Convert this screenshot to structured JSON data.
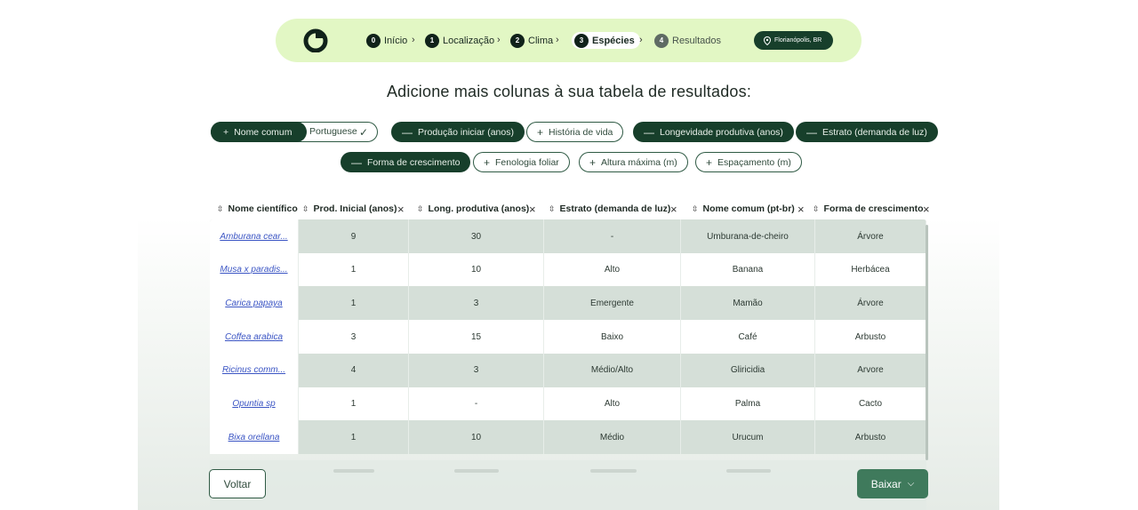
{
  "stepper": {
    "steps": [
      {
        "num": "0",
        "label": "Início"
      },
      {
        "num": "1",
        "label": "Localização"
      },
      {
        "num": "2",
        "label": "Clima"
      },
      {
        "num": "3",
        "label": "Espécies"
      },
      {
        "num": "4",
        "label": "Resultados"
      }
    ],
    "active_step": "3",
    "location": "Florianópolis, BR"
  },
  "heading": "Adicione mais colunas à sua tabela de resultados:",
  "chips": [
    {
      "label": "Nome comum",
      "selected": true,
      "option": "Portuguese"
    },
    {
      "label": "Produção iniciar (anos)",
      "selected": true
    },
    {
      "label": "História de vida",
      "selected": false
    },
    {
      "label": "Longevidade produtiva (anos)",
      "selected": true
    },
    {
      "label": "Estrato (demanda de luz)",
      "selected": true
    },
    {
      "label": "Forma de crescimento",
      "selected": true
    },
    {
      "label": "Fenologia foliar",
      "selected": false
    },
    {
      "label": "Altura máxima (m)",
      "selected": false
    },
    {
      "label": "Espaçamento (m)",
      "selected": false
    }
  ],
  "table": {
    "columns": [
      "Nome científico",
      "Prod. Inicial (anos)",
      "Long. produtiva (anos)",
      "Estrato (demanda de luz)",
      "Nome comum (pt-br)",
      "Forma de crescimento"
    ],
    "rows": [
      [
        "Amburana cear...",
        "9",
        "30",
        "-",
        "Umburana-de-cheiro",
        "Árvore"
      ],
      [
        "Musa x paradis...",
        "1",
        "10",
        "Alto",
        "Banana",
        "Herbácea"
      ],
      [
        "Carica papaya",
        "1",
        "3",
        "Emergente",
        "Mamão",
        "Árvore"
      ],
      [
        "Coffea arabica",
        "3",
        "15",
        "Baixo",
        "Café",
        "Arbusto"
      ],
      [
        "Ricinus comm...",
        "4",
        "3",
        "Médio/Alto",
        "Gliricidia",
        "Arvore"
      ],
      [
        "Opuntia sp",
        "1",
        "-",
        "Alto",
        "Palma",
        "Cacto"
      ],
      [
        "Bixa orellana",
        "1",
        "10",
        "Médio",
        "Urucum",
        "Arbusto"
      ]
    ]
  },
  "buttons": {
    "back": "Voltar",
    "download": "Baixar"
  },
  "colors": {
    "stepper_bg": "#e2f7c4",
    "dark_green": "#173f2b",
    "download_green": "#3f7a5c",
    "row_alt": "#d5dfd8",
    "link_blue": "#3b55c4"
  }
}
